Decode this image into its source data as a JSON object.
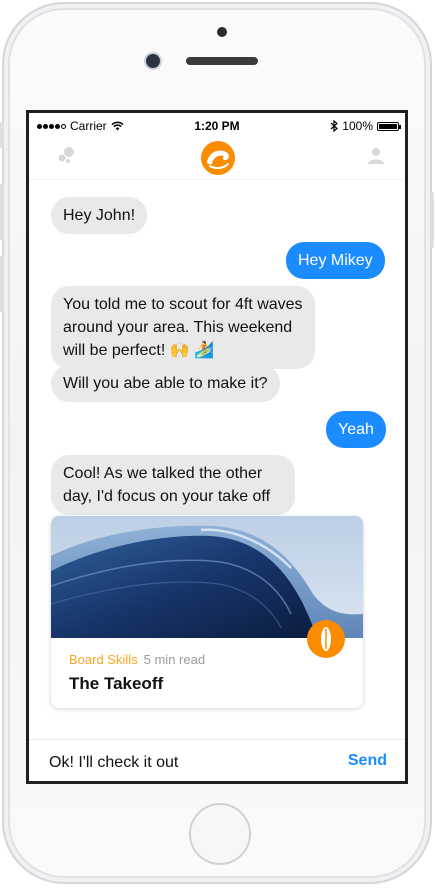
{
  "status_bar": {
    "carrier": "Carrier",
    "time": "1:20 PM",
    "battery": "100%"
  },
  "nav": {
    "left_icon": "bubbles-icon",
    "logo_icon": "wave-logo-icon",
    "right_icon": "person-icon",
    "accent": "#fb8c00"
  },
  "messages": [
    {
      "side": "in",
      "text": "Hey John!"
    },
    {
      "side": "out",
      "text": "Hey Mikey"
    },
    {
      "side": "in",
      "text": "You told me to scout for 4ft waves around your area. This weekend will be perfect! 🙌 🏄"
    },
    {
      "side": "in",
      "text": "Will you abe able to make it?"
    },
    {
      "side": "out",
      "text": "Yeah"
    },
    {
      "side": "in",
      "text": "Cool! As we talked the other day, I'd focus on your take off"
    }
  ],
  "card": {
    "category": "Board Skills",
    "read_time": "5 min read",
    "title": "The Takeoff",
    "badge_icon": "surfboard-icon"
  },
  "composer": {
    "value": "Ok! I'll check it out",
    "send_label": "Send"
  },
  "colors": {
    "incoming_bubble": "#e9e9eb",
    "outgoing_bubble": "#1a8cff",
    "category": "#f5a623"
  }
}
